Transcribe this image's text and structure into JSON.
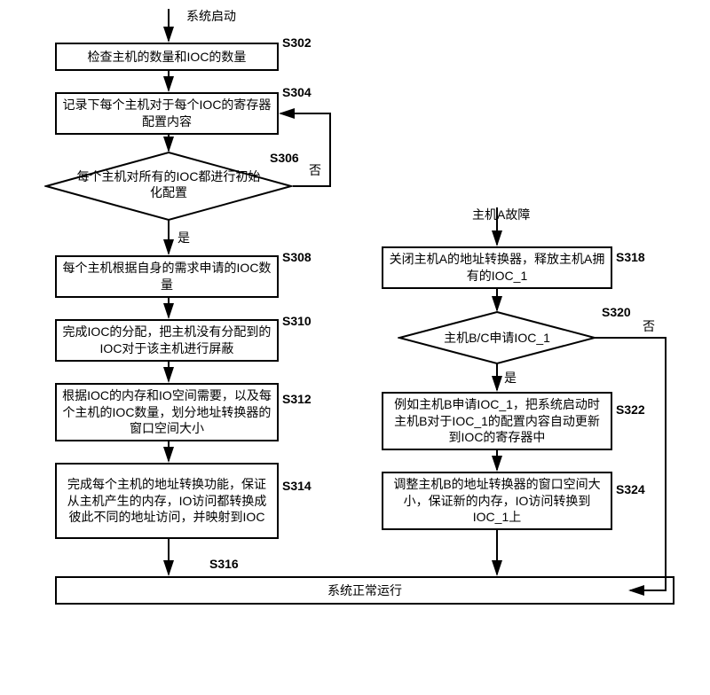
{
  "start_label": "系统启动",
  "s302": {
    "id": "S302",
    "text": "检查主机的数量和IOC的数量"
  },
  "s304": {
    "id": "S304",
    "text": "记录下每个主机对于每个IOC的寄存器配置内容"
  },
  "s306": {
    "id": "S306",
    "text": "每个主机对所有的IOC都进行初始化配置",
    "yes": "是",
    "no": "否"
  },
  "s308": {
    "id": "S308",
    "text": "每个主机根据自身的需求申请的IOC数量"
  },
  "s310": {
    "id": "S310",
    "text": "完成IOC的分配，把主机没有分配到的IOC对于该主机进行屏蔽"
  },
  "s312": {
    "id": "S312",
    "text": "根据IOC的内存和IO空间需要，以及每个主机的IOC数量，划分地址转换器的窗口空间大小"
  },
  "s314": {
    "id": "S314",
    "text": "完成每个主机的地址转换功能，保证从主机产生的内存，IO访问都转换成彼此不同的地址访问，并映射到IOC"
  },
  "s316": {
    "id": "S316",
    "text": "系统正常运行"
  },
  "fault_label": "主机A故障",
  "s318": {
    "id": "S318",
    "text": "关闭主机A的地址转换器，释放主机A拥有的IOC_1"
  },
  "s320": {
    "id": "S320",
    "text": "主机B/C申请IOC_1",
    "yes": "是",
    "no": "否"
  },
  "s322": {
    "id": "S322",
    "text": "例如主机B申请IOC_1，把系统启动时主机B对于IOC_1的配置内容自动更新到IOC的寄存器中"
  },
  "s324": {
    "id": "S324",
    "text": "调整主机B的地址转换器的窗口空间大小，保证新的内存，IO访问转换到IOC_1上"
  }
}
